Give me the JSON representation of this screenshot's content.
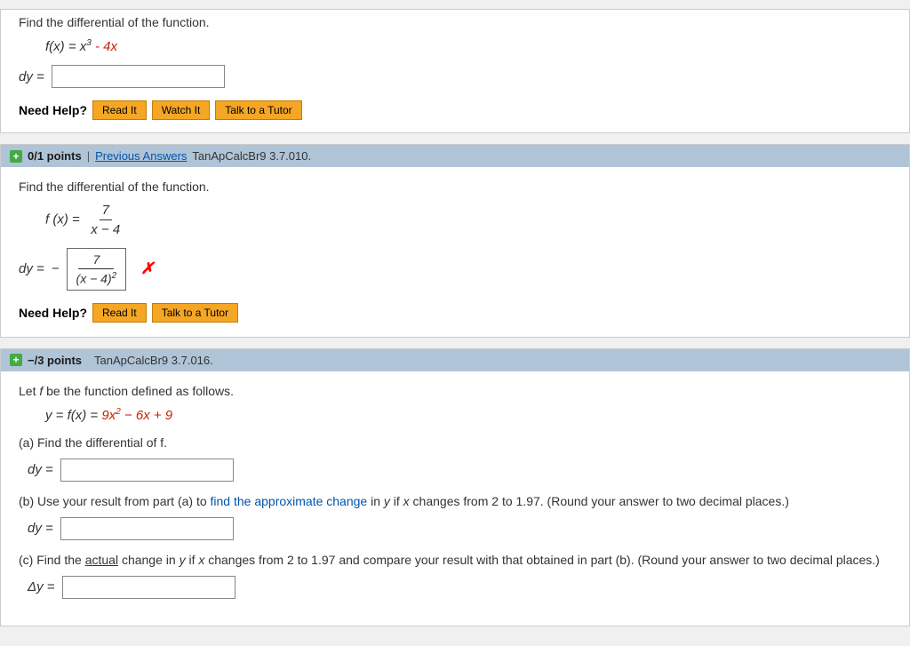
{
  "section1": {
    "instruction": "Find the differential of the function.",
    "function_text": "f(x) = x",
    "function_exp": "3",
    "function_rest": " - 4x",
    "dy_label": "dy =",
    "need_help_label": "Need Help?",
    "buttons": [
      "Read It",
      "Watch It",
      "Talk to a Tutor"
    ]
  },
  "section2": {
    "points": "0/1 points",
    "sep": "|",
    "prev_answers": "Previous Answers",
    "problem_id": "TanApCalcBr9 3.7.010.",
    "instruction": "Find the differential of the function.",
    "function_label": "f (x) =",
    "frac_num": "7",
    "frac_den": "x − 4",
    "dy_label": "dy =",
    "frac_box_num": "7",
    "frac_box_den": "(x − 4)",
    "frac_box_den_exp": "2",
    "need_help_label": "Need Help?",
    "buttons": [
      "Read It",
      "Talk to a Tutor"
    ]
  },
  "section3": {
    "points": "−/3 points",
    "problem_id": "TanApCalcBr9 3.7.016.",
    "instruction": "Let f be the function defined as follows.",
    "function_line": "y = f(x) = 9x",
    "func_exp1": "2",
    "func_rest": " − 6x + 9",
    "part_a_label": "(a) Find the differential of f.",
    "dy_label_a": "dy =",
    "part_b_label": "(b) Use your result from part (a) to find the approximate change in y if x changes from 2 to 1.97. (Round your answer to two decimal places.)",
    "dy_label_b": "dy =",
    "part_c_label": "(c) Find the actual change in y if x changes from 2 to 1.97 and compare your result with that obtained in part (b). (Round your answer to two decimal places.)",
    "delta_y_label": "Δy ="
  },
  "icons": {
    "plus": "+"
  }
}
